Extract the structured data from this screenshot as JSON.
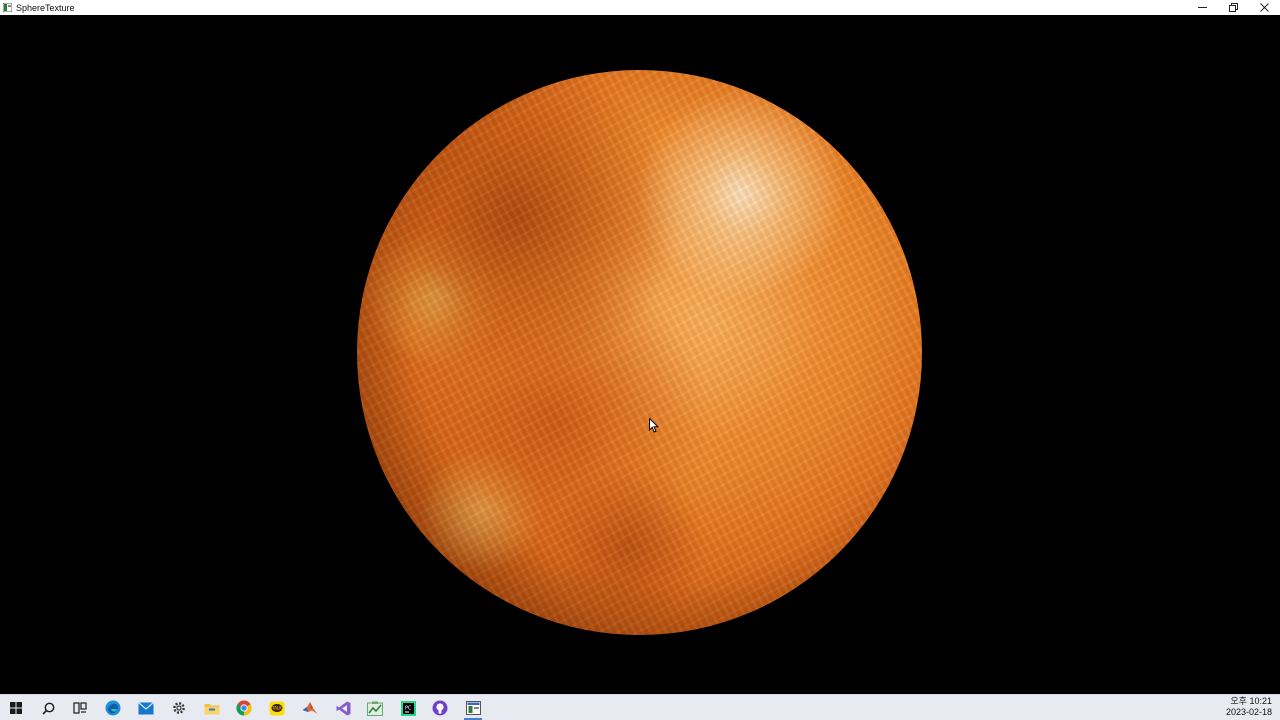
{
  "window": {
    "title": "SphereTexture",
    "controls": {
      "minimize_icon": "minimize-icon",
      "restore_icon": "restore-icon",
      "close_icon": "close-icon"
    }
  },
  "scene": {
    "object": "textured-sphere",
    "background_color": "#000000",
    "planet_colors": [
      "#f5a24a",
      "#ee8a2c",
      "#d9691a",
      "#b24a0c",
      "#7a2d06"
    ]
  },
  "taskbar": {
    "items": [
      {
        "name": "start-icon"
      },
      {
        "name": "search-icon"
      },
      {
        "name": "task-view-icon"
      },
      {
        "name": "edge-icon"
      },
      {
        "name": "mail-icon"
      },
      {
        "name": "settings-gear-icon"
      },
      {
        "name": "file-explorer-icon"
      },
      {
        "name": "chrome-icon"
      },
      {
        "name": "kakaotalk-icon"
      },
      {
        "name": "matlab-icon"
      },
      {
        "name": "visual-studio-icon"
      },
      {
        "name": "app-green-icon"
      },
      {
        "name": "pycharm-icon"
      },
      {
        "name": "github-desktop-icon"
      },
      {
        "name": "spheretexture-app-icon",
        "active": true
      }
    ],
    "clock": {
      "time": "오후 10:21",
      "date": "2023-02-18"
    }
  }
}
